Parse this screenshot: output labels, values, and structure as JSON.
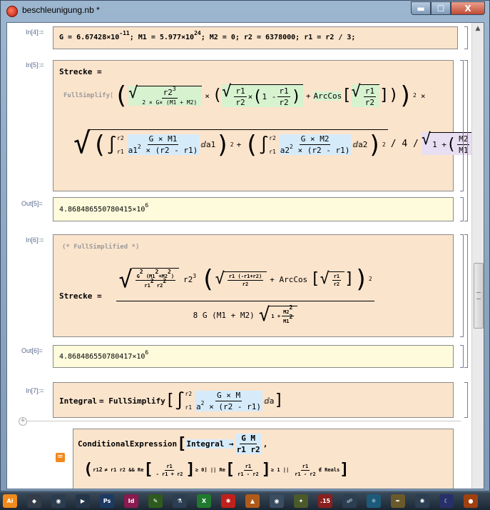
{
  "window": {
    "title": "beschleunigung.nb *",
    "minimize": "▬",
    "maximize": "☐",
    "close": "X"
  },
  "taskbar": {
    "items": [
      {
        "name": "illustrator-icon",
        "label": "Ai",
        "color": "#f08a1c"
      },
      {
        "name": "inkscape-icon",
        "label": "◆",
        "color": "#333c48"
      },
      {
        "name": "eye-app-icon",
        "label": "◉",
        "color": "#2b3c4f"
      },
      {
        "name": "media-player-icon",
        "label": "▶",
        "color": "#26364a"
      },
      {
        "name": "photoshop-icon",
        "label": "Ps",
        "color": "#1d3a63"
      },
      {
        "name": "indesign-icon",
        "label": "Id",
        "color": "#8a1a4f"
      },
      {
        "name": "green-pen-icon",
        "label": "✎",
        "color": "#2f5a1e"
      },
      {
        "name": "flask-icon",
        "label": "⚗",
        "color": "#2c3e52"
      },
      {
        "name": "excel-icon",
        "label": "X",
        "color": "#1f7a2f"
      },
      {
        "name": "mathematica-icon",
        "label": "✱",
        "color": "#c0201a"
      },
      {
        "name": "matlab-icon",
        "label": "▲",
        "color": "#b05a1a"
      },
      {
        "name": "wolfram-player-icon",
        "label": "◉",
        "color": "#3a4c60"
      },
      {
        "name": "puzzle-icon",
        "label": "✦",
        "color": "#4a5a2a"
      },
      {
        "name": "calendar-icon",
        "label": ".15",
        "color": "#8a1f1f"
      },
      {
        "name": "network-icon",
        "label": "☍",
        "color": "#2c3e52"
      },
      {
        "name": "atom-icon",
        "label": "⚛",
        "color": "#1d5a7a"
      },
      {
        "name": "pen-tool-icon",
        "label": "✒",
        "color": "#6a5a2a"
      },
      {
        "name": "compass-icon",
        "label": "✺",
        "color": "#2c3e52"
      },
      {
        "name": "night-icon",
        "label": "☾",
        "color": "#28306a"
      },
      {
        "name": "orb-icon",
        "label": "●",
        "color": "#a04010"
      }
    ]
  },
  "cells": {
    "in4": {
      "label": "In[4]:=",
      "g_lhs": "G = 6.67428",
      "g_mant": "×10",
      "g_exp": "-11",
      "m1": "; M1 = 5.977",
      "m1_mant": "×10",
      "m1_exp": "24",
      "rest": "; M2 = 0; r2 = 6378000; r1 = r2 / 3;"
    },
    "in5": {
      "label": "In[5]:=",
      "lhs": "Strecke",
      "eq": "=",
      "fs": "FullSimplify",
      "r2_3": "r2",
      "exp3": "3",
      "denom": "2 × G× (M1 + M2)",
      "times": "×",
      "r1": "r1",
      "r2": "r2",
      "one_minus": "1 -",
      "arccos": "ArcCos",
      "sq_exp": "2",
      "int_lim_hi": "r2",
      "int_lim_lo": "r1",
      "gm1": "G × M1",
      "a1": "a1",
      "a_exp": "2",
      "diff1": "× (r2 - r1)",
      "da1": "ⅆa1",
      "plus": "+",
      "gm2": "G × M2",
      "a2": "a2",
      "da2": "ⅆa2",
      "div4": "/ 4 /",
      "one_plus": "1 +",
      "m2": "M2",
      "m1": "M1"
    },
    "out5": {
      "label": "Out[5]=",
      "mant": "4.868486550780415",
      "x10": "×10",
      "exp": "6"
    },
    "in6": {
      "label": "In[6]:=",
      "comment": "(* FullSimplified *)",
      "lhs": "Strecke",
      "eq": "=",
      "g2": "G",
      "g2exp": "2",
      "msum": "(M1",
      "m1e": "2",
      "plus_m2": "+M2",
      "m2e": "2",
      "msum_close": ")",
      "r1r2": "r1",
      "r1r2b": "r2",
      "r2cube": "r2",
      "cube": "3",
      "inner_num": "r1 (-r1+r2)",
      "inner_den": "r2",
      "arccos": "+ ArcCos",
      "r1": "r1",
      "r2": "r2",
      "den_main": "8 G (M1 + M2)",
      "one_plus": "1 +",
      "m2": "M2",
      "m1": "M1"
    },
    "out6": {
      "label": "Out[6]=",
      "mant": "4.868486550780417",
      "x10": "×10",
      "exp": "6"
    },
    "in7": {
      "label": "In[7]:=",
      "lhs": "Integral",
      "eq": "= FullSimplify",
      "lo": "r1",
      "hi": "r2",
      "num": "G × M",
      "a": "a",
      "diff": "× (r2 - r1)",
      "da": "ⅆa"
    },
    "out7": {
      "cond": "ConditionalExpression",
      "integral": "Integral →",
      "gm": "G M",
      "r1r2": "r1 r2",
      "line2a": "r1",
      "line2b": "≠ r1 r2 && Re",
      "f1n": "r1",
      "f1d": "- r1 + r2",
      "ge0": "≥ 0] || Re",
      "f2n": "r1",
      "f2d": "r1 - r2",
      "ge1": "≥ 1 ||",
      "f3n": "r1",
      "f3d": "r1 - r2",
      "reals": "∉ Reals"
    }
  }
}
